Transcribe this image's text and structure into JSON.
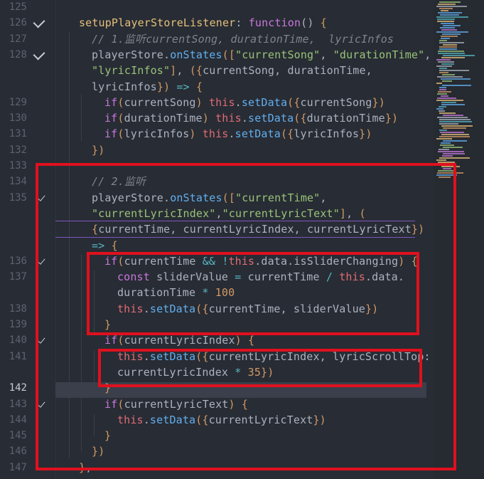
{
  "editor": {
    "theme_colors": {
      "background": "#282c34",
      "highlight_box": "#e0101e"
    },
    "active_line_number": "142",
    "lines": [
      {
        "n": "125",
        "text": ""
      },
      {
        "n": "126",
        "text": "setupPlayerStoreListener: function() {"
      },
      {
        "n": "127",
        "text": "// 1.监听currentSong, durationTime,  lyricInfos"
      },
      {
        "n": "128",
        "text": "playerStore.onStates([\"currentSong\", \"durationTime\","
      },
      {
        "n": "",
        "text": "\"lyricInfos\"], ({currentSong, durationTime,"
      },
      {
        "n": "",
        "text": "lyricInfos}) => {"
      },
      {
        "n": "129",
        "text": "if(currentSong) this.setData({currentSong})"
      },
      {
        "n": "130",
        "text": "if(durationTime) this.setData({durationTime})"
      },
      {
        "n": "131",
        "text": "if(lyricInfos) this.setData({lyricInfos})"
      },
      {
        "n": "132",
        "text": "})"
      },
      {
        "n": "133",
        "text": ""
      },
      {
        "n": "134",
        "text": "// 2.监听"
      },
      {
        "n": "135",
        "text": "playerStore.onStates([\"currentTime\","
      },
      {
        "n": "",
        "text": "\"currentLyricIndex\",\"currentLyricText\"], ("
      },
      {
        "n": "",
        "text": "{currentTime, currentLyricIndex, currentLyricText})"
      },
      {
        "n": "",
        "text": "=> {"
      },
      {
        "n": "136",
        "text": "if(currentTime && !this.data.isSliderChanging) {"
      },
      {
        "n": "137",
        "text": "const sliderValue = currentTime / this.data."
      },
      {
        "n": "",
        "text": "durationTime * 100"
      },
      {
        "n": "138",
        "text": "this.setData({currentTime, sliderValue})"
      },
      {
        "n": "139",
        "text": "}"
      },
      {
        "n": "140",
        "text": "if(currentLyricIndex) {"
      },
      {
        "n": "141",
        "text": "this.setData({currentLyricIndex, lyricScrollTop:"
      },
      {
        "n": "",
        "text": "currentLyricIndex * 35})"
      },
      {
        "n": "142",
        "text": "}"
      },
      {
        "n": "143",
        "text": "if(currentLyricText) {"
      },
      {
        "n": "144",
        "text": "this.setData({currentLyricText})"
      },
      {
        "n": "145",
        "text": "}"
      },
      {
        "n": "146",
        "text": "})"
      },
      {
        "n": "147",
        "text": "},"
      }
    ]
  }
}
